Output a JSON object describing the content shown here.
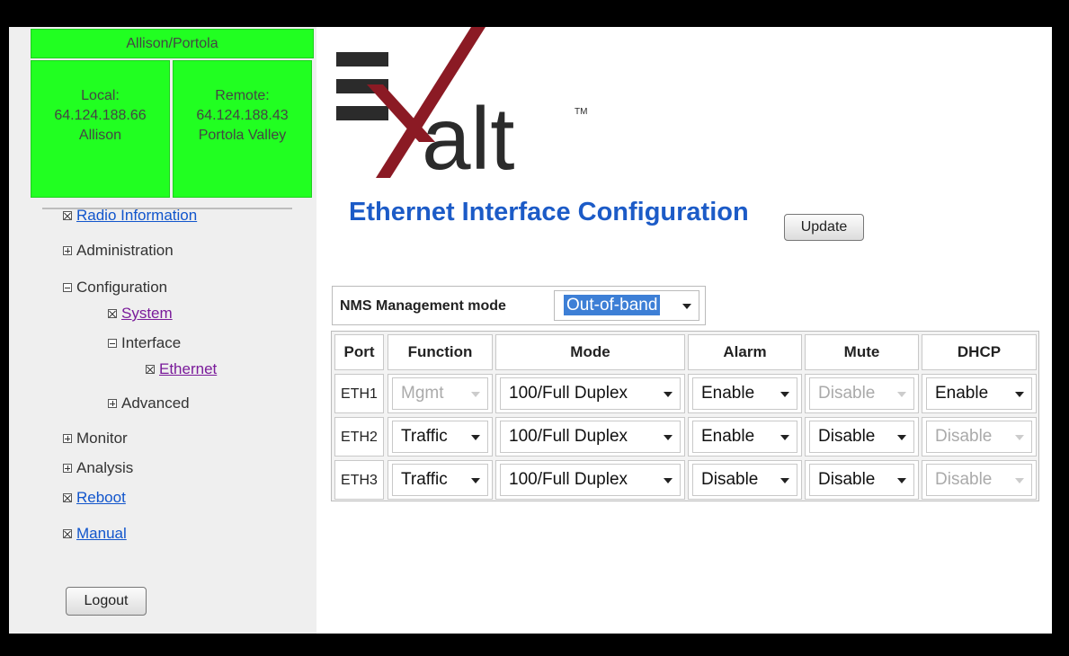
{
  "device": {
    "title": "Allison/Portola",
    "local": {
      "label": "Local:",
      "ip": "64.124.188.66",
      "name": "Allison"
    },
    "remote": {
      "label": "Remote:",
      "ip": "64.124.188.43",
      "name": "Portola Valley"
    }
  },
  "colors": {
    "status_green": "#21ff21",
    "title_blue": "#1c5bc7",
    "logo_red": "#8b1a24",
    "logo_dark": "#2b2b2b"
  },
  "nav": {
    "radio_information": "Radio Information",
    "administration": "Administration",
    "configuration": "Configuration",
    "system": "System",
    "interface": "Interface",
    "ethernet": "Ethernet",
    "advanced": "Advanced",
    "monitor": "Monitor",
    "analysis": "Analysis",
    "reboot": "Reboot",
    "manual": "Manual"
  },
  "logout_label": "Logout",
  "logo": {
    "text": "alt",
    "tm": "TM"
  },
  "page": {
    "title": "Ethernet Interface Configuration",
    "update_label": "Update"
  },
  "nms": {
    "label": "NMS Management mode",
    "value": "Out-of-band"
  },
  "table": {
    "headers": {
      "port": "Port",
      "function": "Function",
      "mode": "Mode",
      "alarm": "Alarm",
      "mute": "Mute",
      "dhcp": "DHCP"
    },
    "rows": [
      {
        "port": "ETH1",
        "function": "Mgmt",
        "mode": "100/Full Duplex",
        "alarm": "Enable",
        "mute": "Disable",
        "dhcp": "Enable"
      },
      {
        "port": "ETH2",
        "function": "Traffic",
        "mode": "100/Full Duplex",
        "alarm": "Enable",
        "mute": "Disable",
        "dhcp": "Disable"
      },
      {
        "port": "ETH3",
        "function": "Traffic",
        "mode": "100/Full Duplex",
        "alarm": "Disable",
        "mute": "Disable",
        "dhcp": "Disable"
      }
    ]
  }
}
